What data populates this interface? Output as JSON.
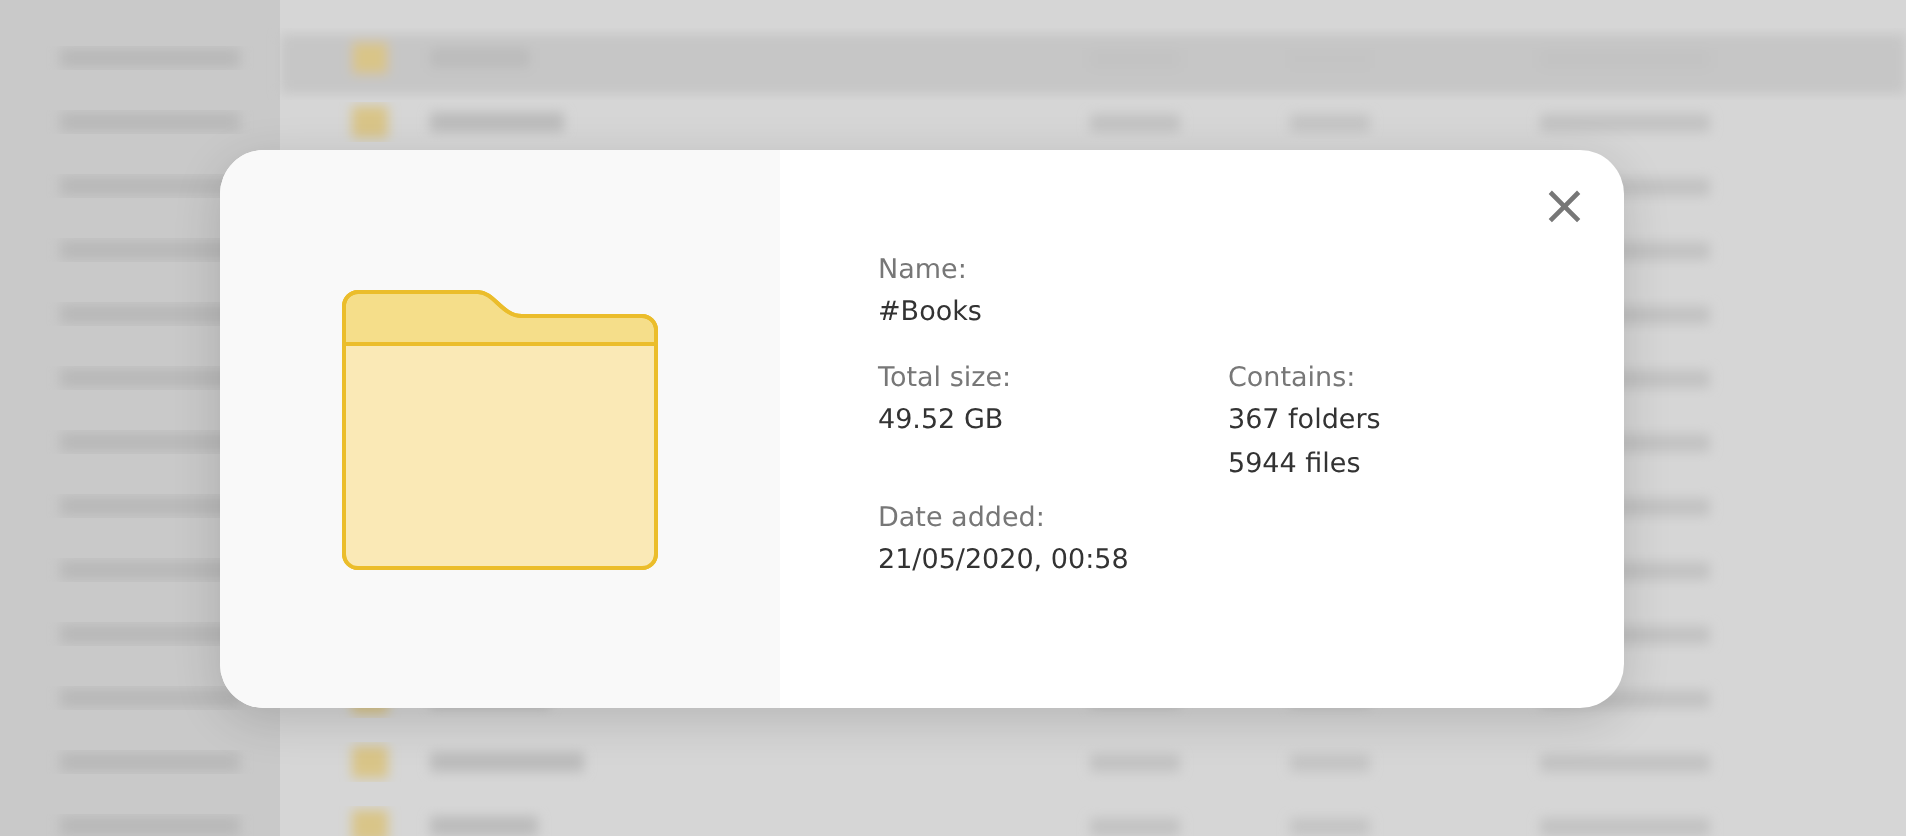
{
  "dialog": {
    "name_label": "Name:",
    "name": "#Books",
    "size_label": "Total size:",
    "size": "49.52 GB",
    "contains_label": "Contains:",
    "contains": [
      "367 folders",
      "5944 files"
    ],
    "date_label": "Date added:",
    "date": "21/05/2020, 00:58",
    "close": "×"
  }
}
